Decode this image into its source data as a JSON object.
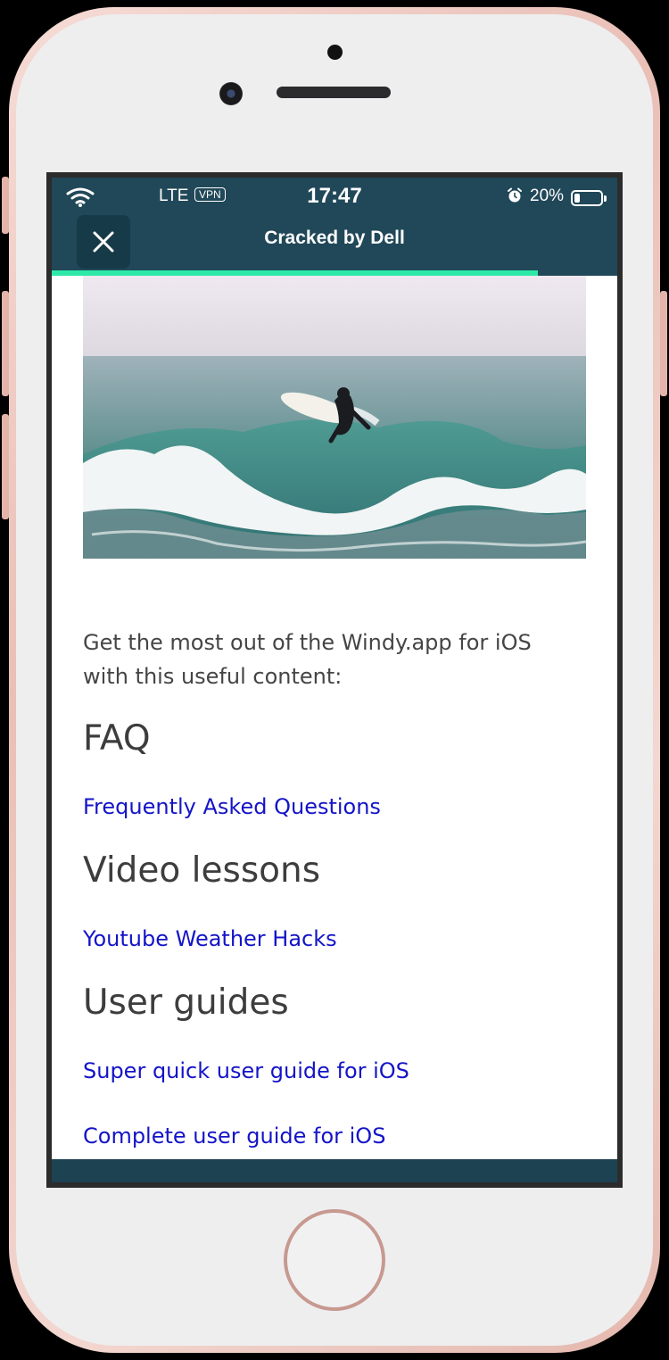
{
  "status_bar": {
    "carrier": "LTE",
    "vpn": "VPN",
    "time": "17:47",
    "battery_percent": "20%",
    "battery_level": 0.2
  },
  "nav": {
    "title": "Cracked by Dell",
    "load_progress": 0.86
  },
  "content": {
    "intro": "Get the most out of the Windy.app for iOS with this useful content:",
    "sections": [
      {
        "heading": "FAQ",
        "links": [
          "Frequently Asked Questions"
        ]
      },
      {
        "heading": "Video lessons",
        "links": [
          "Youtube Weather Hacks"
        ]
      },
      {
        "heading": "User guides",
        "links": [
          "Super quick user guide for iOS",
          "Complete user guide for iOS"
        ]
      }
    ]
  },
  "colors": {
    "nav_background": "#214858",
    "progress": "#2ee8a8",
    "link": "#1414c8",
    "text": "#454545"
  }
}
